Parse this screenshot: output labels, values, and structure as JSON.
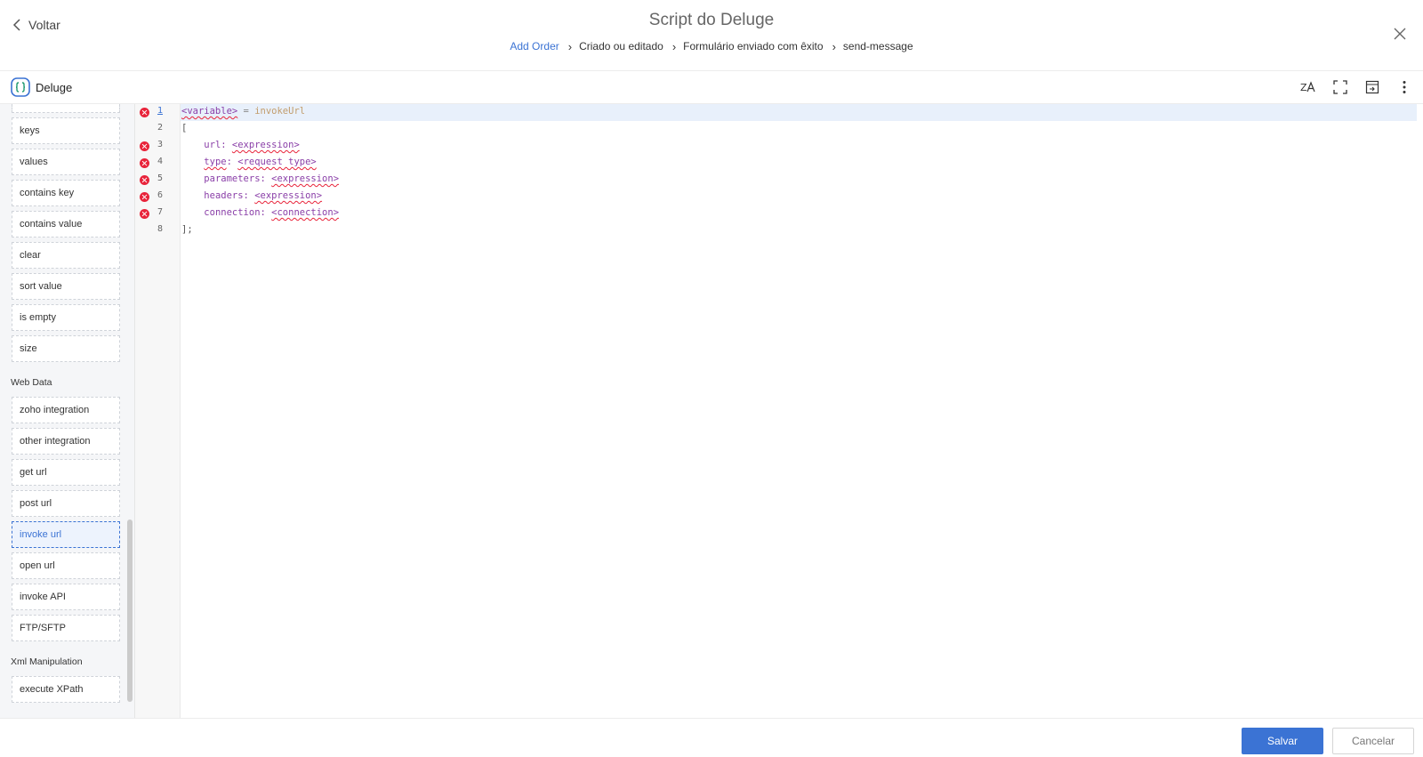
{
  "header": {
    "back_label": "Voltar",
    "title": "Script do Deluge",
    "breadcrumb": [
      "Add Order",
      "Criado ou editado",
      "Formulário enviado com êxito",
      "send-message"
    ]
  },
  "toolbar": {
    "logo_label": "Deluge",
    "icons": [
      "translate-icon",
      "fullscreen-icon",
      "panel-toggle-icon",
      "more-vertical-icon"
    ]
  },
  "sidebar": {
    "group1": [
      "keys",
      "values",
      "contains key",
      "contains value",
      "clear",
      "sort value",
      "is empty",
      "size"
    ],
    "web_data_heading": "Web Data",
    "web_data": [
      "zoho integration",
      "other integration",
      "get url",
      "post url",
      "invoke url",
      "open url",
      "invoke API",
      "FTP/SFTP"
    ],
    "active_item": "invoke url",
    "xml_heading": "Xml Manipulation",
    "xml": [
      "execute XPath"
    ]
  },
  "editor": {
    "line_numbers": [
      "1",
      "2",
      "3",
      "4",
      "5",
      "6",
      "7",
      "8"
    ],
    "error_lines": [
      1,
      3,
      4,
      5,
      6,
      7
    ],
    "current_line": 1,
    "tokens": {
      "l1_var": "<variable>",
      "l1_eq": " = ",
      "l1_fn": "invokeUrl",
      "l2": "[",
      "l3_key": "url: ",
      "l3_val": "<expression>",
      "l4_key": "type",
      "l4_colon": ": ",
      "l4_val": "<request type>",
      "l5_key": "parameters: ",
      "l5_val": "<expression>",
      "l6_key": "headers: ",
      "l6_val": "<expression>",
      "l7_key": "connection: ",
      "l7_val": "<connection>",
      "l8": "];"
    }
  },
  "footer": {
    "save_label": "Salvar",
    "cancel_label": "Cancelar"
  },
  "colors": {
    "accent": "#3b73d4",
    "error": "#e8233a",
    "keyword": "#8a3fa8"
  }
}
